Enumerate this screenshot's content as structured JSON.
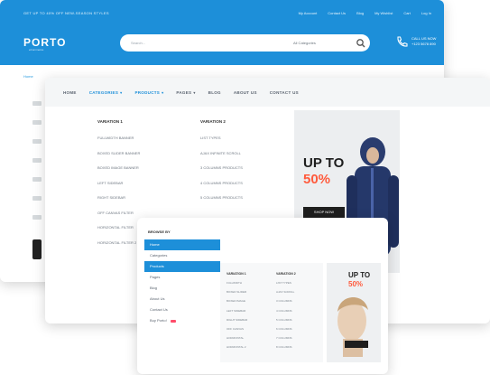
{
  "header": {
    "notice": "GET UP TO 40% OFF NEW-SEASON STYLES",
    "top_links": [
      "My Account",
      "Contact Us",
      "Blog",
      "My Wishlist",
      "Cart",
      "Log In"
    ],
    "logo": "PORTO",
    "logo_tagline": "eCommerce",
    "search_placeholder": "Search...",
    "search_category": "All Categories",
    "phone_label": "CALL US NOW",
    "phone_number": "+123 5678 890",
    "breadcrumb": "Home"
  },
  "nav": {
    "items": [
      {
        "label": "HOME",
        "active": false,
        "caret": false
      },
      {
        "label": "CATEGORIES",
        "active": true,
        "caret": true
      },
      {
        "label": "PRODUCTS",
        "active": true,
        "caret": true
      },
      {
        "label": "PAGES",
        "active": false,
        "caret": true
      },
      {
        "label": "BLOG",
        "active": false,
        "caret": false
      },
      {
        "label": "ABOUT US",
        "active": false,
        "caret": false
      },
      {
        "label": "CONTACT US",
        "active": false,
        "caret": false
      }
    ]
  },
  "megamenu": {
    "col1": {
      "heading": "VARIATION 1",
      "items": [
        "FULLWIDTH BANNER",
        "BOXED SLIDER BANNER",
        "BOXED IMAGE BANNER",
        "LEFT SIDEBAR",
        "RIGHT SIDEBAR",
        "OFF CANVAS FILTER",
        "HORIZONTAL FILTER",
        "HORIZONTAL FILTER 2"
      ]
    },
    "col2": {
      "heading": "VARIATION 2",
      "items": [
        "LIST TYPES",
        "AJAX INFINITE SCROLL",
        "3 COLUMNS PRODUCTS",
        "4 COLUMNS PRODUCTS",
        "5 COLUMNS PRODUCTS"
      ]
    },
    "promo": {
      "headline": "UP TO",
      "percent": "50%",
      "button": "SHOP NOW"
    }
  },
  "mobile": {
    "title": "BROWSE BY",
    "items": [
      {
        "label": "Home",
        "selected": true,
        "badge": false
      },
      {
        "label": "Categories",
        "selected": false,
        "badge": false
      },
      {
        "label": "Products",
        "selected": true,
        "badge": false
      },
      {
        "label": "Pages",
        "selected": false,
        "badge": false
      },
      {
        "label": "Blog",
        "selected": false,
        "badge": false
      },
      {
        "label": "About Us",
        "selected": false,
        "badge": false
      },
      {
        "label": "Contact Us",
        "selected": false,
        "badge": false
      },
      {
        "label": "Buy Porto!",
        "selected": false,
        "badge": true
      }
    ],
    "sub_col1": {
      "heading": "VARIATION 1",
      "items": [
        "FULLWIDTH",
        "BOXED SLIDER",
        "BOXED IMAGE",
        "LEFT SIDEBAR",
        "RIGHT SIDEBAR",
        "OFF CANVAS",
        "HORIZONTAL",
        "HORIZONTAL 2"
      ]
    },
    "sub_col2": {
      "heading": "VARIATION 2",
      "items": [
        "LIST TYPES",
        "AJAX SCROLL",
        "3 COLUMNS",
        "4 COLUMNS",
        "5 COLUMNS",
        "6 COLUMNS",
        "7 COLUMNS",
        "8 COLUMNS"
      ]
    },
    "promo": {
      "headline": "UP TO",
      "percent": "50%"
    }
  },
  "colors": {
    "brand": "#1d8fd9",
    "accent": "#ff5a3c",
    "badge": "#ff4c6a"
  }
}
